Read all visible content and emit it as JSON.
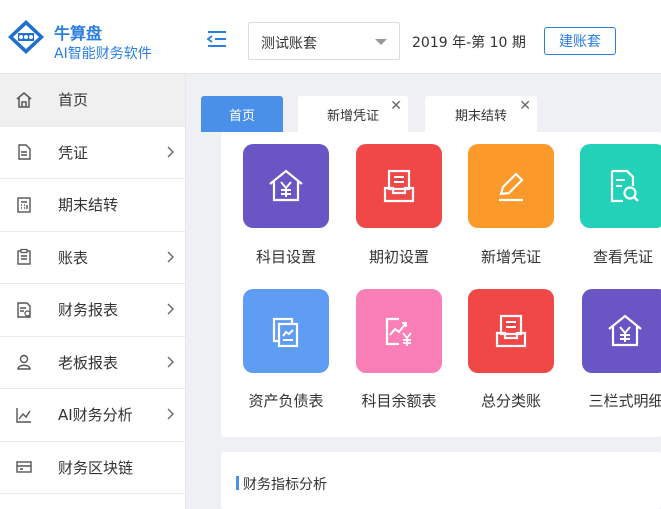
{
  "app": {
    "name": "牛算盘",
    "subtitle": "AI智能财务软件"
  },
  "sidebar": {
    "items": [
      {
        "label": "首页",
        "icon": "home-icon"
      },
      {
        "label": "凭证",
        "icon": "document-icon"
      },
      {
        "label": "期末结转",
        "icon": "calculator-icon"
      },
      {
        "label": "账表",
        "icon": "clipboard-icon"
      },
      {
        "label": "财务报表",
        "icon": "report-icon"
      },
      {
        "label": "老板报表",
        "icon": "person-icon"
      },
      {
        "label": "AI财务分析",
        "icon": "line-chart-icon"
      },
      {
        "label": "财务区块链",
        "icon": "blockchain-icon"
      }
    ]
  },
  "header": {
    "account": "测试账套",
    "period": "2019 年-第 10 期",
    "create_label": "建账套"
  },
  "tabs": [
    {
      "label": "首页"
    },
    {
      "label": "新增凭证"
    },
    {
      "label": "期末结转"
    }
  ],
  "shortcuts": [
    {
      "label": "科目设置",
      "color": "#6a55c5",
      "icon": "house-yen-icon"
    },
    {
      "label": "期初设置",
      "color": "#f04747",
      "icon": "tray-icon"
    },
    {
      "label": "新增凭证",
      "color": "#fb9a2b",
      "icon": "pen-icon"
    },
    {
      "label": "查看凭证",
      "color": "#22d1b7",
      "icon": "doc-search-icon"
    },
    {
      "label": "资产负债表",
      "color": "#5f9df5",
      "icon": "balance-sheet-icon"
    },
    {
      "label": "科目余额表",
      "color": "#f97fb6",
      "icon": "chart-yen-icon"
    },
    {
      "label": "总分类账",
      "color": "#f04747",
      "icon": "ledger-icon"
    },
    {
      "label": "三栏式明细",
      "color": "#6a55c5",
      "icon": "house-yen-icon"
    }
  ],
  "panel": {
    "title": "财务指标分析"
  },
  "colors": {
    "accent": "#4a90e8",
    "brand": "#2b7fe1"
  }
}
